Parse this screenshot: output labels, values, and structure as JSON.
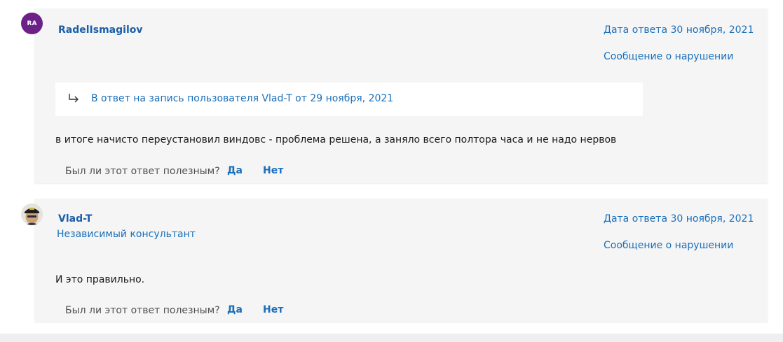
{
  "posts": [
    {
      "avatar_initials": "RA",
      "avatar_color": "#6b2188",
      "author": "RadelIsmagilov",
      "role": "",
      "date": "Дата ответа 30 ноября, 2021",
      "report": "Сообщение о нарушении",
      "reply_to": "В ответ на запись пользователя Vlad-T от 29 ноября, 2021",
      "body": "в итоге начисто переустановил виндовс - проблема решена, а заняло всего полтора часа и не надо нервов",
      "helpful_question": "Был ли этот ответ полезным?",
      "yes": "Да",
      "no": "Нет"
    },
    {
      "avatar_initials": "",
      "author": "Vlad-T",
      "role": "Независимый консультант",
      "date": "Дата ответа 30 ноября, 2021",
      "report": "Сообщение о нарушении",
      "body": "И это правильно.",
      "helpful_question": "Был ли этот ответ полезным?",
      "yes": "Да",
      "no": "Нет"
    }
  ],
  "colors": {
    "link": "#1a6fba",
    "card_bg": "#f5f5f5",
    "author": "#1a5fa8"
  },
  "icons": {
    "reply": "reply-arrow-icon"
  }
}
